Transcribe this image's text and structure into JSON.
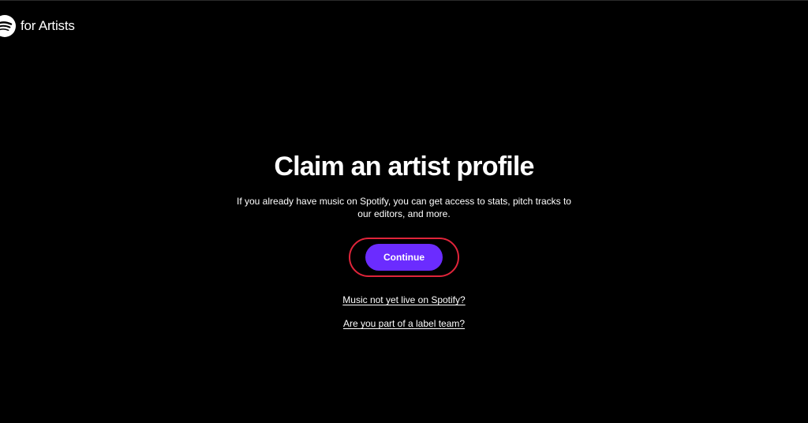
{
  "header": {
    "brand_text": "for Artists",
    "logo_icon": "spotify-logo-icon"
  },
  "main": {
    "title": "Claim an artist profile",
    "description": "If you already have music on Spotify, you can get access to stats, pitch tracks to our editors, and more.",
    "continue_label": "Continue",
    "link_not_live": "Music not yet live on Spotify?",
    "link_label_team": "Are you part of a label team?"
  },
  "colors": {
    "background": "#000000",
    "text": "#ffffff",
    "button": "#6b2cff",
    "highlight_outline": "#e0243a"
  }
}
